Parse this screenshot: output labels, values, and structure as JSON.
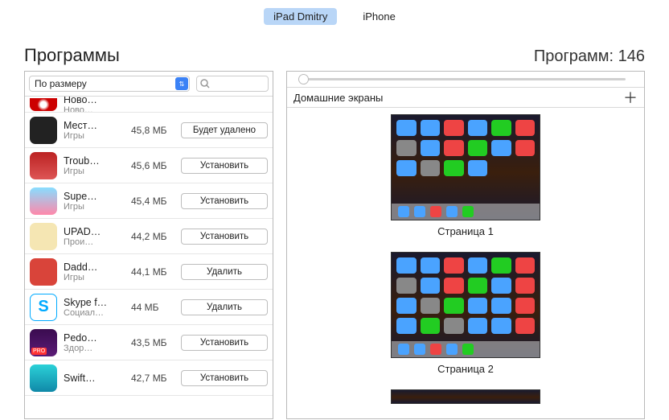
{
  "tabs": {
    "ipad": "iPad Dmitry",
    "iphone": "iPhone"
  },
  "header": {
    "title": "Программы",
    "count_label": "Программ: 146"
  },
  "sort": {
    "label": "По размеру"
  },
  "apps": [
    {
      "name": "Ново…",
      "genre": "Ново…",
      "size": "",
      "action": ""
    },
    {
      "name": "Мест…",
      "genre": "Игры",
      "size": "45,8 МБ",
      "action": "Будет удалено"
    },
    {
      "name": "Troub…",
      "genre": "Игры",
      "size": "45,6 МБ",
      "action": "Установить"
    },
    {
      "name": "Supe…",
      "genre": "Игры",
      "size": "45,4 МБ",
      "action": "Установить"
    },
    {
      "name": "UPAD…",
      "genre": "Прои…",
      "size": "44,2 МБ",
      "action": "Установить"
    },
    {
      "name": "Dadd…",
      "genre": "Игры",
      "size": "44,1 МБ",
      "action": "Удалить"
    },
    {
      "name": "Skype f…",
      "genre": "Социал…",
      "size": "44 МБ",
      "action": "Удалить"
    },
    {
      "name": "Pedo…",
      "genre": "Здор…",
      "size": "43,5 МБ",
      "action": "Установить"
    },
    {
      "name": "Swift…",
      "genre": "",
      "size": "42,7 МБ",
      "action": "Установить"
    }
  ],
  "right": {
    "section_title": "Домашние экраны",
    "pages": [
      {
        "label": "Страница 1"
      },
      {
        "label": "Страница 2"
      }
    ]
  }
}
